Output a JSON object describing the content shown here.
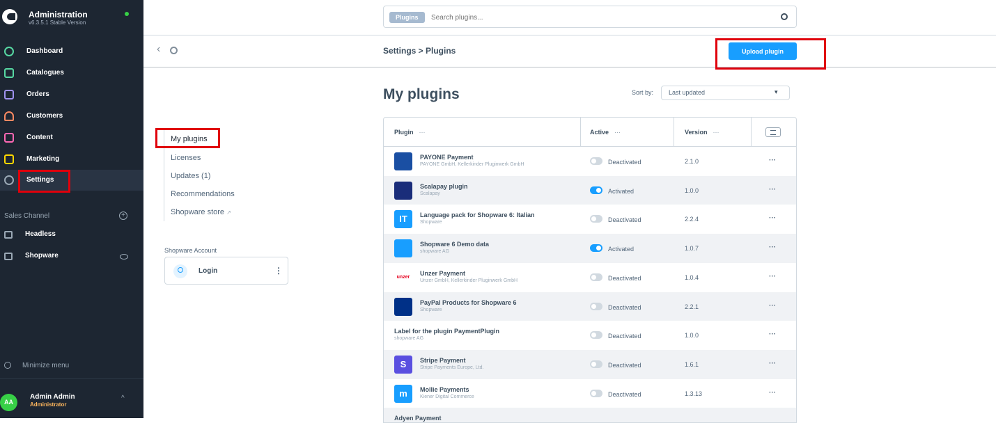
{
  "app": {
    "title": "Administration",
    "version": "v6.3.5.1 Stable Version"
  },
  "sidebar": {
    "items": [
      {
        "label": "Dashboard",
        "color": "#57d9a3"
      },
      {
        "label": "Catalogues",
        "color": "#57d9a3"
      },
      {
        "label": "Orders",
        "color": "#a092f0"
      },
      {
        "label": "Customers",
        "color": "#f88962"
      },
      {
        "label": "Content",
        "color": "#ff68b4"
      },
      {
        "label": "Marketing",
        "color": "#ffd700"
      },
      {
        "label": "Settings",
        "color": "#9aa8b5"
      }
    ],
    "sales_channel_title": "Sales Channel",
    "channels": [
      {
        "label": "Headless"
      },
      {
        "label": "Shopware"
      }
    ],
    "minimize": "Minimize menu",
    "user": {
      "initials": "AA",
      "name": "Admin Admin",
      "role": "Administrator"
    }
  },
  "search": {
    "tag": "Plugins",
    "placeholder": "Search plugins..."
  },
  "smartbar": {
    "breadcrumb": "Settings > Plugins",
    "upload_label": "Upload plugin"
  },
  "leftnav": {
    "items": [
      "My plugins",
      "Licenses",
      "Updates (1)",
      "Recommendations",
      "Shopware store"
    ],
    "store_ext": "↗",
    "account_title": "Shopware Account",
    "login_label": "Login"
  },
  "main": {
    "title": "My plugins",
    "sort_label": "Sort by:",
    "sort_value": "Last updated"
  },
  "grid": {
    "headers": {
      "plugin": "Plugin",
      "active": "Active",
      "version": "Version",
      "dots": "⋯"
    },
    "rows": [
      {
        "name": "PAYONE Payment",
        "maker": "PAYONE GmbH, Kellerkinder Pluginwerk GmbH",
        "status": "Deactivated",
        "active": false,
        "version": "2.1.0",
        "logo": "payone",
        "logo_color": "#1a4fa3"
      },
      {
        "name": "Scalapay plugin",
        "maker": "Scalapay",
        "status": "Activated",
        "active": true,
        "version": "1.0.0",
        "logo": "scalapay",
        "logo_color": "#1a2d7a"
      },
      {
        "name": "Language pack for Shopware 6: Italian",
        "maker": "Shopware",
        "status": "Deactivated",
        "active": false,
        "version": "2.2.4",
        "logo": "IT",
        "logo_color": "#189eff"
      },
      {
        "name": "Shopware 6 Demo data",
        "maker": "shopware AG",
        "status": "Activated",
        "active": true,
        "version": "1.0.7",
        "logo": "demo",
        "logo_color": "#189eff"
      },
      {
        "name": "Unzer Payment",
        "maker": "Unzer GmbH, Kellerkinder Pluginwerk GmbH",
        "status": "Deactivated",
        "active": false,
        "version": "1.0.4",
        "logo": "unzer",
        "logo_color": "#e6001e"
      },
      {
        "name": "PayPal Products for Shopware 6",
        "maker": "Shopware",
        "status": "Deactivated",
        "active": false,
        "version": "2.2.1",
        "logo": "paypal",
        "logo_color": "#003087"
      },
      {
        "name": "Label for the plugin PaymentPlugin",
        "maker": "shopware AG",
        "status": "Deactivated",
        "active": false,
        "version": "1.0.0",
        "logo": "",
        "logo_color": ""
      },
      {
        "name": "Stripe Payment",
        "maker": "Stripe Payments Europe, Ltd.",
        "status": "Deactivated",
        "active": false,
        "version": "1.6.1",
        "logo": "S",
        "logo_color": "#5a4fe0"
      },
      {
        "name": "Mollie Payments",
        "maker": "Kiener Digital Commerce",
        "status": "Deactivated",
        "active": false,
        "version": "1.3.13",
        "logo": "m",
        "logo_color": "#189eff"
      },
      {
        "name": "Adyen Payment",
        "maker": "",
        "status": "",
        "active": false,
        "version": "",
        "logo": "",
        "logo_color": ""
      }
    ]
  }
}
